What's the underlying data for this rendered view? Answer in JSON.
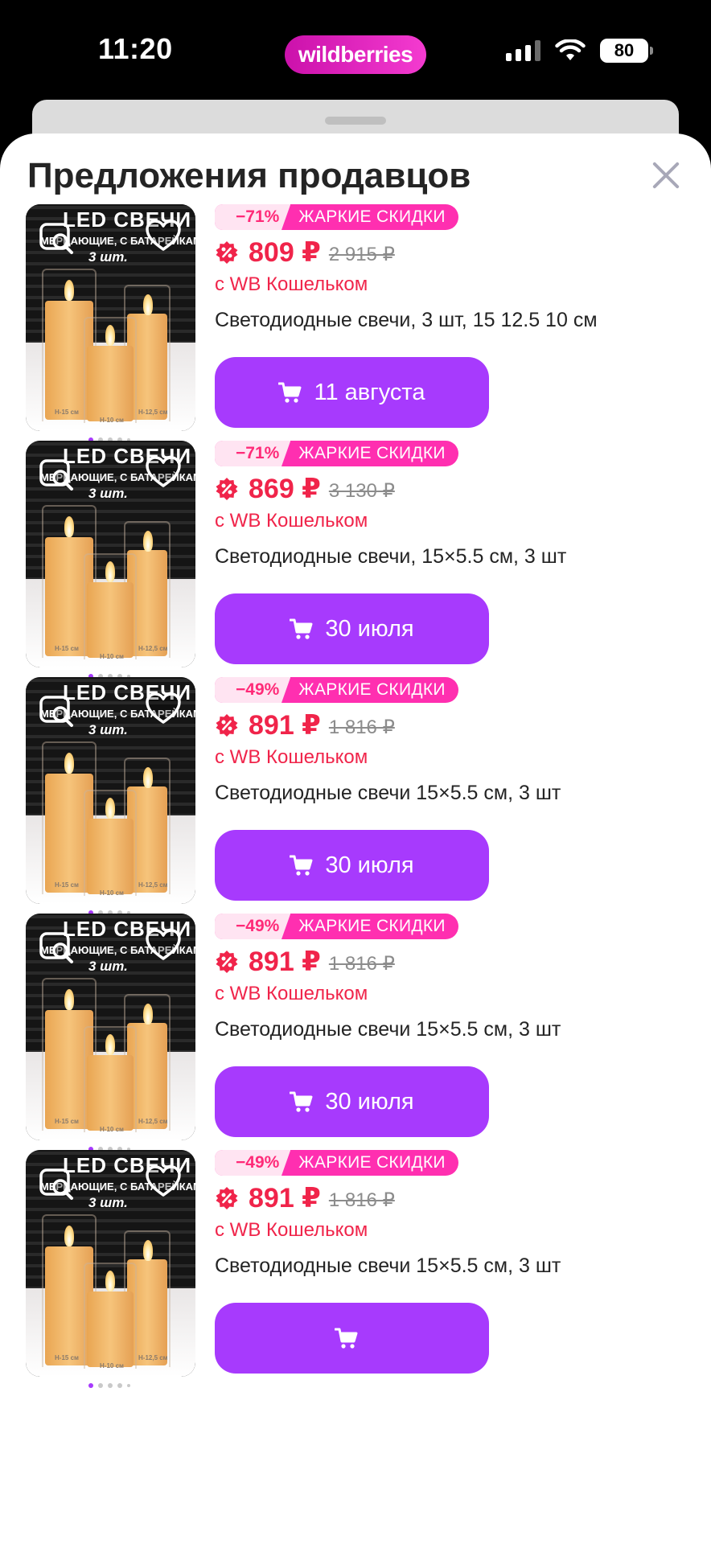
{
  "status_bar": {
    "time": "11:20",
    "brand": "wildberries",
    "battery": "80"
  },
  "sheet": {
    "title": "Предложения продавцов"
  },
  "thumb_text": {
    "line1": "LED СВЕЧИ",
    "line2": "МЕРЦАЮЩИЕ, С БАТАРЕЙКАМИ",
    "line3": "3 шт.",
    "h15": "H-15 см",
    "h10": "H-10 см",
    "h125": "H-12,5 см"
  },
  "offers": [
    {
      "discount": "−71%",
      "promo": "ЖАРКИЕ СКИДКИ",
      "price": "809 ₽",
      "old_price": "2 915 ₽",
      "wallet": "с WB Кошельком",
      "title": "Светодиодные свечи, 3 шт, 15 12.5 10 см",
      "delivery": "11 августа"
    },
    {
      "discount": "−71%",
      "promo": "ЖАРКИЕ СКИДКИ",
      "price": "869 ₽",
      "old_price": "3 130 ₽",
      "wallet": "с WB Кошельком",
      "title": "Светодиодные свечи, 15×5.5 см, 3 шт",
      "delivery": "30 июля"
    },
    {
      "discount": "−49%",
      "promo": "ЖАРКИЕ СКИДКИ",
      "price": "891 ₽",
      "old_price": "1 816 ₽",
      "wallet": "с WB Кошельком",
      "title": "Светодиодные свечи 15×5.5 см, 3 шт",
      "delivery": "30 июля"
    },
    {
      "discount": "−49%",
      "promo": "ЖАРКИЕ СКИДКИ",
      "price": "891 ₽",
      "old_price": "1 816 ₽",
      "wallet": "с WB Кошельком",
      "title": "Светодиодные свечи 15×5.5 см, 3 шт",
      "delivery": "30 июля"
    },
    {
      "discount": "−49%",
      "promo": "ЖАРКИЕ СКИДКИ",
      "price": "891 ₽",
      "old_price": "1 816 ₽",
      "wallet": "с WB Кошельком",
      "title": "Светодиодные свечи 15×5.5 см, 3 шт",
      "delivery": ""
    }
  ],
  "colors": {
    "accent": "#a73afd",
    "price": "#f0244a",
    "promo": "#ff2fb0",
    "brand": "#cb11ab"
  },
  "icons": [
    "signal-icon",
    "wifi-icon",
    "battery-icon",
    "close-icon",
    "heart-icon",
    "image-search-icon",
    "wallet-discount-icon",
    "cart-icon"
  ]
}
